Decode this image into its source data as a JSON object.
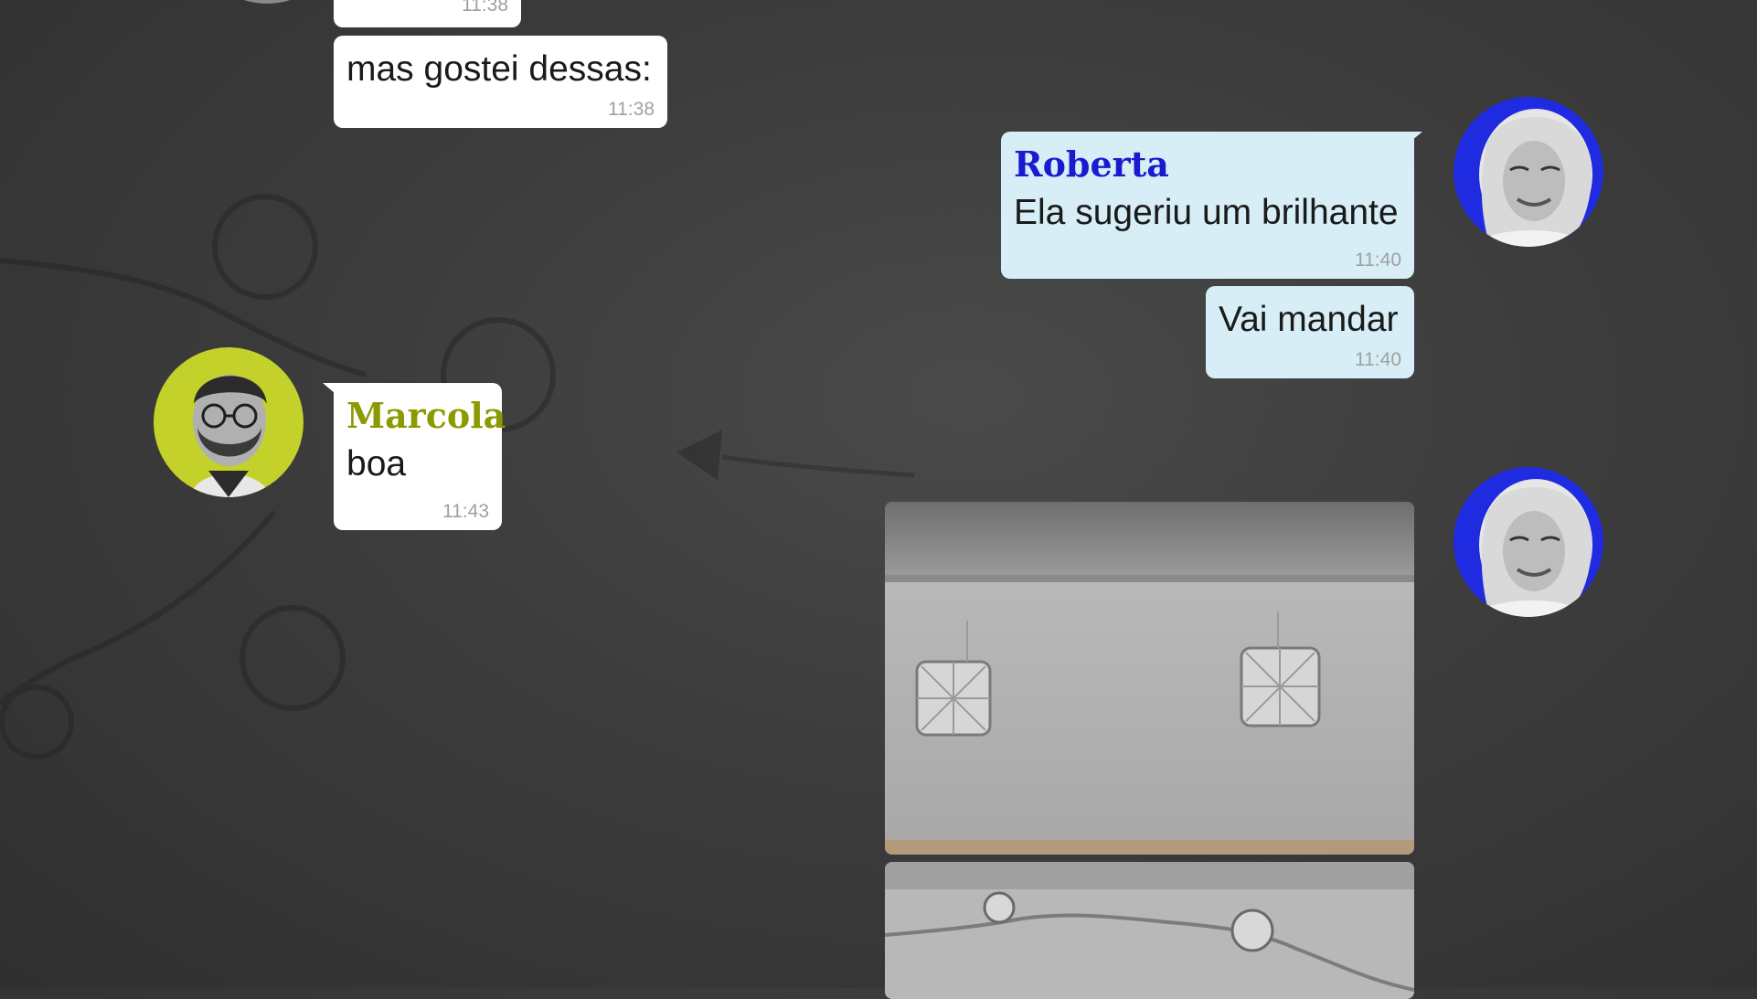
{
  "messages": [
    {
      "id": "m0",
      "direction": "incoming",
      "text": "",
      "time": "11:38"
    },
    {
      "id": "m1",
      "direction": "incoming",
      "text": "mas gostei dessas:",
      "time": "11:38"
    },
    {
      "id": "m2",
      "direction": "outgoing",
      "sender": "Roberta",
      "text": "Ela sugeriu um brilhante",
      "time": "11:40"
    },
    {
      "id": "m3",
      "direction": "outgoing",
      "text": "Vai mandar",
      "time": "11:40"
    },
    {
      "id": "m4",
      "direction": "incoming",
      "sender": "Marcola",
      "text": "boa",
      "time": "11:43"
    },
    {
      "id": "m5",
      "direction": "outgoing",
      "type": "image",
      "content": "earrings-photo"
    },
    {
      "id": "m6",
      "direction": "outgoing",
      "type": "image",
      "content": "necklace-photo"
    }
  ],
  "colors": {
    "roberta_name": "#1a1acf",
    "marcola_name": "#8a9a00",
    "incoming_bubble": "#ffffff",
    "outgoing_bubble": "#d7eef7",
    "roberta_avatar_bg": "#1f2be0",
    "marcola_avatar_bg": "#c3d12a"
  }
}
